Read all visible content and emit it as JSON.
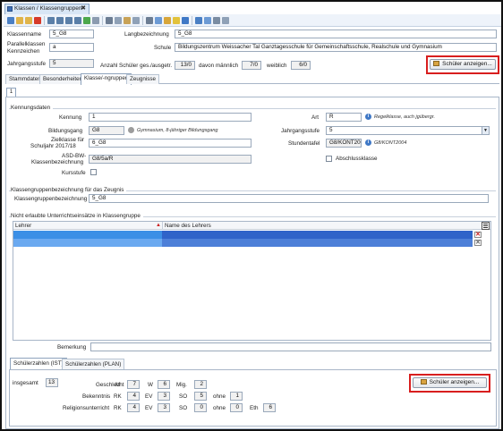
{
  "window": {
    "tab_title": "Klassen / Klassengruppen",
    "pin_glyph": "✖"
  },
  "toolbar": {
    "icons": [
      "save-icon",
      "new-icon",
      "first-icon",
      "prev-icon",
      "next-icon",
      "last-icon",
      "refresh-icon",
      "cut-icon",
      "copy-icon",
      "paste-icon",
      "delete-icon",
      "print-icon",
      "preview-icon",
      "search-icon",
      "bell-icon",
      "help-icon",
      "filter-icon",
      "export-icon",
      "grid-icon",
      "list-icon",
      "settings-icon"
    ]
  },
  "header": {
    "klassenname_label": "Klassenname",
    "klassenname_value": "5_G8",
    "langbezeichnung_label": "Langbezeichnung",
    "langbezeichnung_value": "5_G8",
    "parallel_label_1": "Parallelklassen",
    "parallel_label_2": "Kennzeichen",
    "parallel_value": "a",
    "schule_label": "Schule",
    "schule_value": "Bildungszentrum Weissacher Tal Ganztagesschule für Gemeinschaftsschule, Realschule und Gymnasium",
    "jahrgangsstufe_label": "Jahrgangsstufe",
    "jahrgangsstufe_value": "5",
    "anzahl_label": "Anzahl Schüler ges./ausgetr.",
    "anzahl_value": "13/0",
    "maennlich_label": "davon männlich",
    "maennlich_value": "7/0",
    "weiblich_label": "weiblich",
    "weiblich_value": "6/0",
    "show_students_button": "Schüler anzeigen..."
  },
  "tabs": [
    "Stammdaten",
    "Besonderheiten",
    "Klasse/-ngruppen",
    "Zeugnisse"
  ],
  "active_tab": "Klasse/-ngruppen",
  "subtab": "1",
  "kennung": {
    "group_title": "Kennungsdaten",
    "kennung_label": "Kennung",
    "kennung_value": "1",
    "art_label": "Art",
    "art_value": "R",
    "art_hint": "Regelklasse, auch jgübergr.",
    "bildungsgang_label": "Bildungsgang",
    "bildungsgang_value": "G8",
    "bildungsgang_hint": "Gymnasium, 8-jähriger Bildungsgang",
    "jahrgangsstufe_label": "Jahrgangsstufe",
    "jahrgangsstufe_value": "5",
    "zielklasse_label_1": "Zielklasse für",
    "zielklasse_label_2": "Schuljahr 2017/18",
    "zielklasse_value": "6_G8",
    "stundentafel_label": "Stundentafel",
    "stundentafel_value": "G8/KONT2004",
    "stundentafel_hint": "G8/KONT2004",
    "asd_label_1": "ASD-BW-",
    "asd_label_2": "Klassenbezeichnung",
    "asd_value": "G8/5a/R",
    "abschluss_label": "Abschlussklasse",
    "kursstufe_label": "Kursstufe"
  },
  "zeugnis": {
    "group_title": "Klassengruppenbezeichnung für das Zeugnis",
    "label": "Klassengruppenbezeichnung",
    "value": "5_G8"
  },
  "einsatz": {
    "group_title": "Nicht erlaubte Unterrichtseinsätze in Klassengruppe",
    "col_lehrer": "Lehrer",
    "col_name": "Name des Lehrers",
    "delete_glyph": "✕"
  },
  "bemerkung": {
    "label": "Bemerkung",
    "value": ""
  },
  "lower_tabs": [
    "Schülerzahlen (IST)",
    "Schülerzahlen (PLAN)"
  ],
  "schuelerzahlen": {
    "insgesamt_label": "insgesamt",
    "insgesamt_value": "13",
    "geschlecht_label": "Geschlecht",
    "m_label": "M",
    "m_value": "7",
    "w_label": "W",
    "w_value": "6",
    "mig_label": "Mig.",
    "mig_value": "2",
    "bekenntnis_label": "Bekenntnis",
    "bek_rk_label": "RK",
    "bek_rk_value": "4",
    "bek_ev_label": "EV",
    "bek_ev_value": "3",
    "bek_so_label": "SO",
    "bek_so_value": "5",
    "bek_ohne_label": "ohne",
    "bek_ohne_value": "1",
    "religion_label": "Religionsunterricht",
    "rel_rk_label": "RK",
    "rel_rk_value": "4",
    "rel_ev_label": "EV",
    "rel_ev_value": "3",
    "rel_so_label": "SO",
    "rel_so_value": "0",
    "rel_ohne_label": "ohne",
    "rel_ohne_value": "0",
    "rel_eth_label": "Eth",
    "rel_eth_value": "6",
    "show_students_button": "Schüler anzeigen..."
  },
  "colors": {
    "highlight_border": "#d81e1e",
    "selection": "#2f63c9",
    "info_icon": "#3f78c6"
  }
}
